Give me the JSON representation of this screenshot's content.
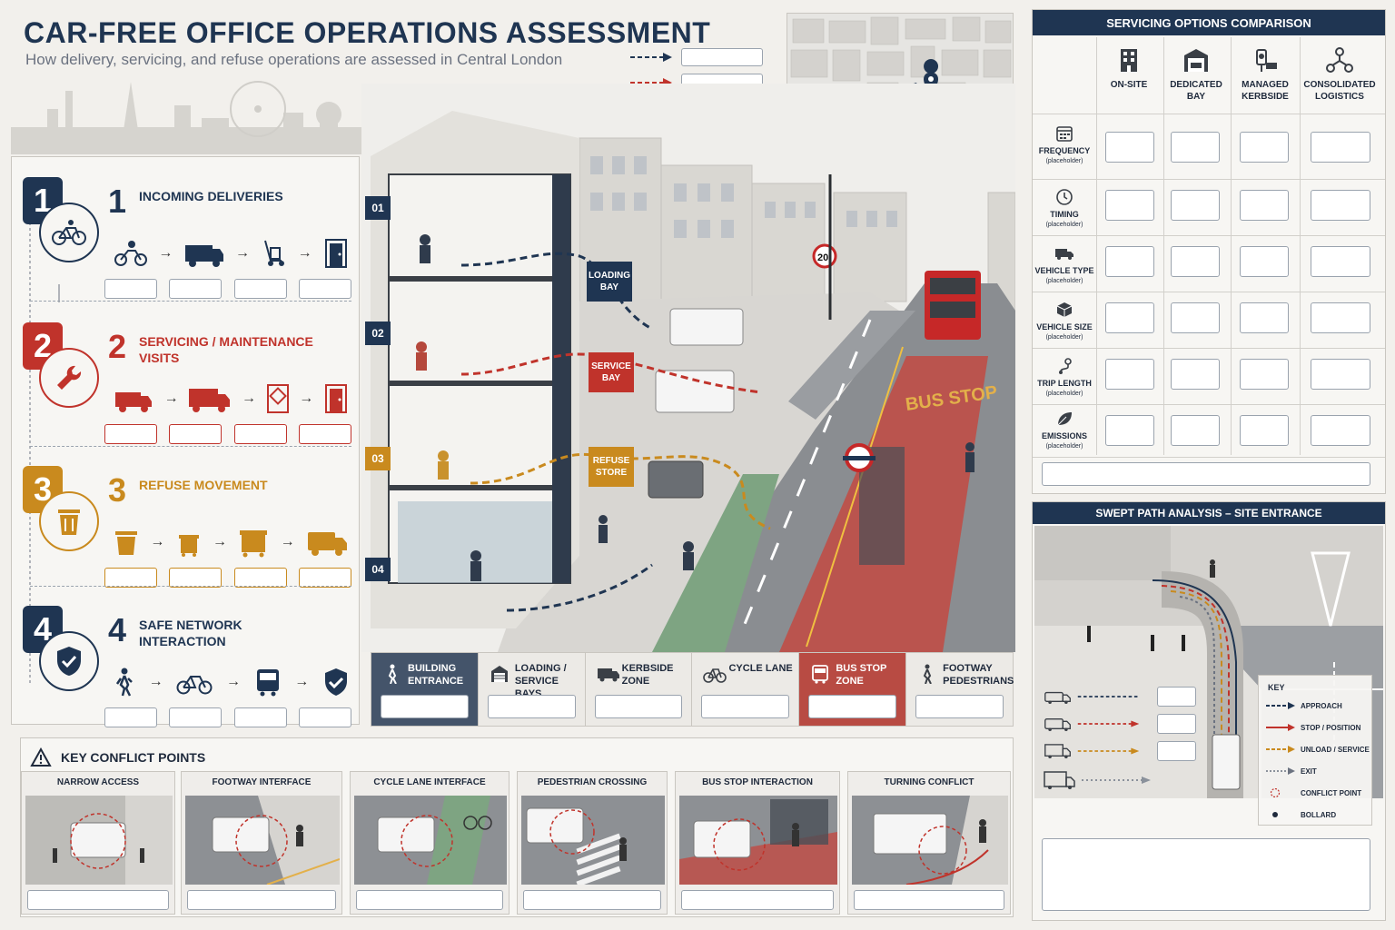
{
  "header": {
    "title": "CAR-FREE OFFICE OPERATIONS ASSESSMENT",
    "subtitle": "How delivery, servicing, and refuse operations are assessed in Central London"
  },
  "map": {
    "north_label": "N"
  },
  "stages": [
    {
      "number": "1",
      "title": "INCOMING DELIVERIES",
      "color": "#1f3552",
      "icon": "bicycle-icon",
      "flow_icons": [
        "cyclist-icon",
        "van-icon",
        "hand-trolley-icon",
        "door-icon"
      ]
    },
    {
      "number": "2",
      "title": "SERVICING / MAINTENANCE VISITS",
      "color": "#c0332b",
      "icon": "wrench-icon",
      "flow_icons": [
        "van-icon",
        "truck-icon",
        "service-panel-icon",
        "door-icon"
      ]
    },
    {
      "number": "3",
      "title": "REFUSE MOVEMENT",
      "color": "#c98a1e",
      "icon": "bin-icon",
      "flow_icons": [
        "bin-icon",
        "small-bin-icon",
        "large-bin-icon",
        "refuse-truck-icon"
      ]
    },
    {
      "number": "4",
      "title": "SAFE NETWORK INTERACTION",
      "color": "#1f3552",
      "icon": "shield-check-icon",
      "flow_icons": [
        "pedestrian-icon",
        "bicycle-icon",
        "bus-icon",
        "shield-check-icon"
      ]
    }
  ],
  "scene": {
    "floors": [
      "01",
      "02",
      "03",
      "04"
    ],
    "bays": [
      {
        "label": "LOADING BAY",
        "color": "#1f3552"
      },
      {
        "label": "SERVICE BAY",
        "color": "#c0332b"
      },
      {
        "label": "REFUSE STORE",
        "color": "#c98a1e"
      }
    ],
    "speed_sign": "20",
    "bus_lane_text": "BUS STOP"
  },
  "zones": [
    {
      "label": "BUILDING ENTRANCE",
      "icon": "pedestrian-icon",
      "bg": "#44546a",
      "fg": "#ffffff"
    },
    {
      "label": "LOADING / SERVICE BAYS",
      "icon": "garage-icon",
      "bg": "#eceae6",
      "fg": "#1f2a3c"
    },
    {
      "label": "KERBSIDE ZONE",
      "icon": "van-icon",
      "bg": "#eceae6",
      "fg": "#1f2a3c"
    },
    {
      "label": "CYCLE LANE",
      "icon": "bicycle-icon",
      "bg": "#eceae6",
      "fg": "#1f2a3c"
    },
    {
      "label": "BUS STOP ZONE",
      "icon": "bus-icon",
      "bg": "#b84b43",
      "fg": "#ffffff"
    },
    {
      "label": "FOOTWAY PEDESTRIANS",
      "icon": "pedestrian-icon",
      "bg": "#eceae6",
      "fg": "#1f2a3c"
    }
  ],
  "conflicts": {
    "heading": "KEY CONFLICT POINTS",
    "cards": [
      {
        "label": "NARROW ACCESS"
      },
      {
        "label": "FOOTWAY INTERFACE"
      },
      {
        "label": "CYCLE LANE INTERFACE"
      },
      {
        "label": "PEDESTRIAN CROSSING"
      },
      {
        "label": "BUS STOP INTERACTION"
      },
      {
        "label": "TURNING CONFLICT"
      }
    ]
  },
  "comparison": {
    "title": "SERVICING OPTIONS COMPARISON",
    "columns": [
      {
        "label": "ON-SITE",
        "icon": "building-icon"
      },
      {
        "label": "DEDICATED BAY",
        "icon": "garage-icon"
      },
      {
        "label": "MANAGED KERBSIDE",
        "icon": "kerbside-icon"
      },
      {
        "label": "CONSOLIDATED LOGISTICS",
        "icon": "network-icon"
      }
    ],
    "rows": [
      {
        "label": "FREQUENCY",
        "note": "(placeholder)",
        "icon": "calendar-icon"
      },
      {
        "label": "TIMING",
        "note": "(placeholder)",
        "icon": "clock-icon"
      },
      {
        "label": "VEHICLE TYPE",
        "note": "(placeholder)",
        "icon": "truck-icon"
      },
      {
        "label": "VEHICLE SIZE",
        "note": "(placeholder)",
        "icon": "box-icon"
      },
      {
        "label": "TRIP LENGTH",
        "note": "(placeholder)",
        "icon": "route-icon"
      },
      {
        "label": "EMISSIONS",
        "note": "(placeholder)",
        "icon": "leaf-icon"
      }
    ]
  },
  "swept": {
    "title": "SWEPT PATH ANALYSIS – SITE ENTRANCE",
    "key_title": "KEY",
    "key": [
      {
        "label": "APPROACH",
        "color": "#1f3552"
      },
      {
        "label": "STOP / POSITION",
        "color": "#c0332b"
      },
      {
        "label": "UNLOAD / SERVICE",
        "color": "#c98a1e"
      },
      {
        "label": "EXIT",
        "color": "#6b7280"
      },
      {
        "label": "CONFLICT POINT",
        "color": "#c0332b"
      },
      {
        "label": "BOLLARD",
        "color": "#1f2a3c"
      }
    ],
    "route_colors": [
      "#1f3552",
      "#c0332b",
      "#c98a1e",
      "#6b7280"
    ]
  }
}
